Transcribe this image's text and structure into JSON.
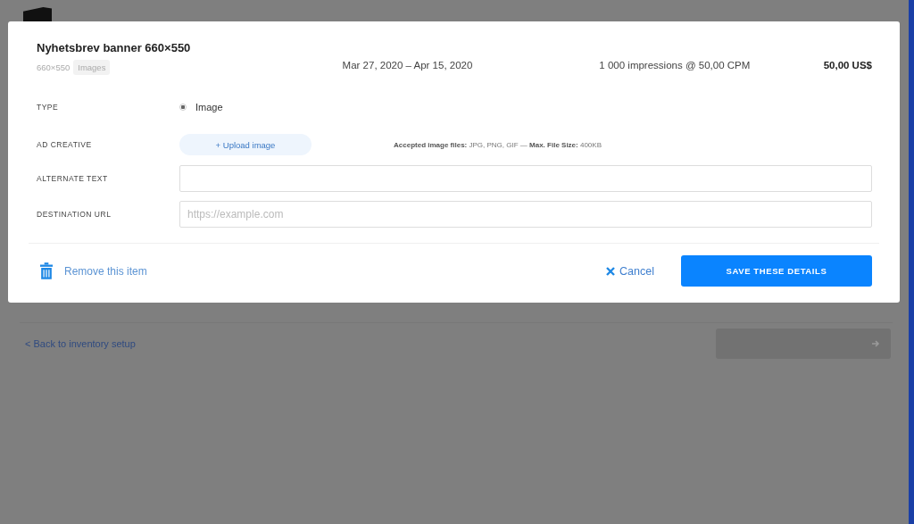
{
  "modal": {
    "title": "Nyhetsbrev banner 660×550",
    "size": "660×550",
    "tag": "Images",
    "dates": "Mar 27, 2020 – Apr 15, 2020",
    "impressions": "1 000 impressions @ 50,00 CPM",
    "price": "50,00 US$",
    "type": {
      "label": "TYPE",
      "options": [
        {
          "label": "Image",
          "selected": true
        }
      ]
    },
    "creative": {
      "label": "AD CREATIVE",
      "button": "+ Upload image",
      "note": "**Accepted image files:** JPG, PNG, GIF — **Max. File Size:** 400KB"
    },
    "fields": [
      {
        "label": "ALTERNATE TEXT"
      },
      {
        "label": "DESTINATION URL",
        "placeholder": "https://example.com"
      }
    ],
    "remove": "Remove this item",
    "cancel": "Cancel",
    "save": "SAVE THESE DETAILS"
  },
  "page": {
    "back_link": "< Back to inventory setup",
    "next_button": {
      "disabled": true
    }
  }
}
